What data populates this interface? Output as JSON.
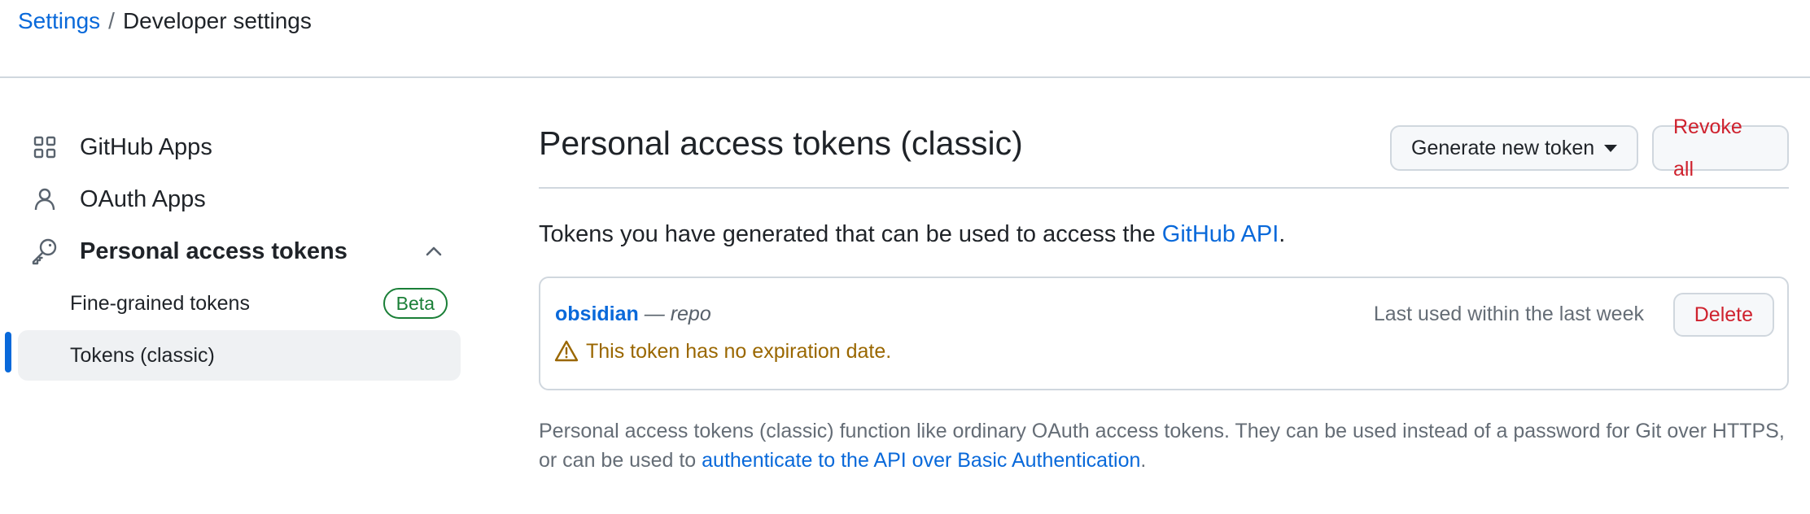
{
  "breadcrumb": {
    "root": "Settings",
    "separator": "/",
    "current": "Developer settings"
  },
  "sidebar": {
    "items": [
      {
        "label": "GitHub Apps",
        "icon": "apps-grid-icon"
      },
      {
        "label": "OAuth Apps",
        "icon": "person-icon"
      },
      {
        "label": "Personal access tokens",
        "icon": "key-icon",
        "expanded": true
      }
    ],
    "sub_items": [
      {
        "label": "Fine-grained tokens",
        "badge": "Beta"
      },
      {
        "label": "Tokens (classic)",
        "selected": true
      }
    ]
  },
  "main": {
    "title": "Personal access tokens (classic)",
    "generate_button": "Generate new token",
    "revoke_button": "Revoke all",
    "intro_text": "Tokens you have generated that can be used to access the ",
    "intro_link": "GitHub API",
    "intro_end": ".",
    "token": {
      "name": "obsidian",
      "scope": " — repo",
      "last_used": "Last used within the last week",
      "delete_button": "Delete",
      "warning": "This token has no expiration date."
    },
    "footnote_text": "Personal access tokens (classic) function like ordinary OAuth access tokens. They can be used instead of a password for Git over HTTPS, or can be used to ",
    "footnote_link": "authenticate to the API over Basic Authentication",
    "footnote_end": "."
  },
  "colors": {
    "link": "#0969da",
    "danger": "#cf222e",
    "success": "#1a7f37",
    "warning": "#9a6700",
    "border": "#d0d7de"
  }
}
